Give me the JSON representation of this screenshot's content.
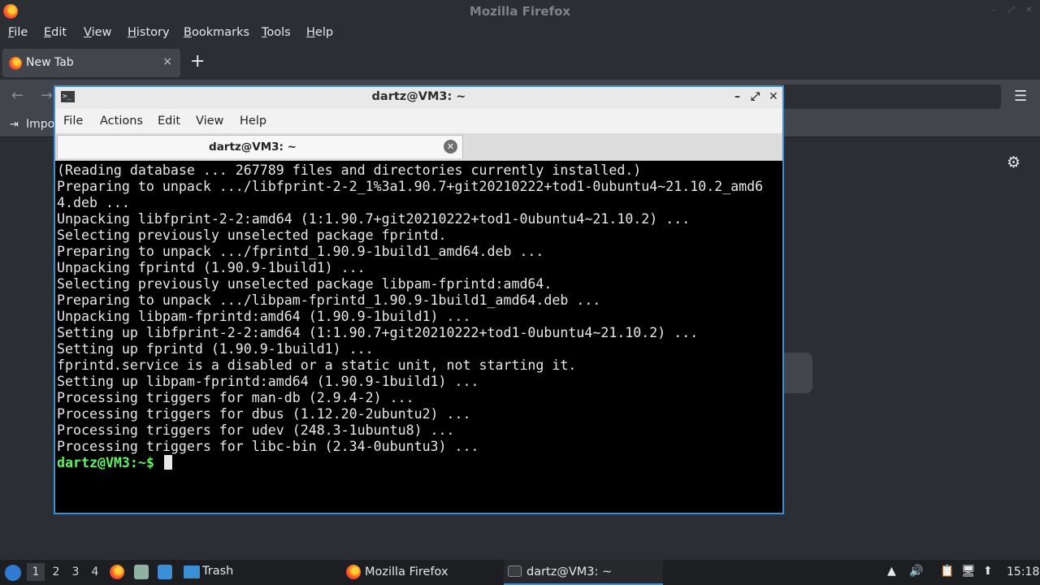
{
  "firefox": {
    "window_title": "Mozilla Firefox",
    "menu": [
      "File",
      "Edit",
      "View",
      "History",
      "Bookmarks",
      "Tools",
      "Help"
    ],
    "tab": {
      "label": "New Tab",
      "close": "×"
    },
    "new_tab_symbol": "+",
    "nav": {
      "back": "←",
      "forward": "→",
      "menu": "☰"
    },
    "bookmarks_toolbar": {
      "import_label": "Impo",
      "import_icon": "⇥"
    },
    "settings_icon": "⚙"
  },
  "terminal": {
    "title": "dartz@VM3: ~",
    "controls": {
      "minimize": "–",
      "maximize": "⤢",
      "close": "✕"
    },
    "menu": [
      "File",
      "Actions",
      "Edit",
      "View",
      "Help"
    ],
    "tab": {
      "label": "dartz@VM3: ~",
      "close": "✕"
    },
    "lines": [
      "(Reading database ... 267789 files and directories currently installed.)",
      "Preparing to unpack .../libfprint-2-2_1%3a1.90.7+git20210222+tod1-0ubuntu4~21.10.2_amd6",
      "4.deb ...",
      "Unpacking libfprint-2-2:amd64 (1:1.90.7+git20210222+tod1-0ubuntu4~21.10.2) ...",
      "Selecting previously unselected package fprintd.",
      "Preparing to unpack .../fprintd_1.90.9-1build1_amd64.deb ...",
      "Unpacking fprintd (1.90.9-1build1) ...",
      "Selecting previously unselected package libpam-fprintd:amd64.",
      "Preparing to unpack .../libpam-fprintd_1.90.9-1build1_amd64.deb ...",
      "Unpacking libpam-fprintd:amd64 (1.90.9-1build1) ...",
      "Setting up libfprint-2-2:amd64 (1:1.90.7+git20210222+tod1-0ubuntu4~21.10.2) ...",
      "Setting up fprintd (1.90.9-1build1) ...",
      "fprintd.service is a disabled or a static unit, not starting it.",
      "Setting up libpam-fprintd:amd64 (1.90.9-1build1) ...",
      "Processing triggers for man-db (2.9.4-2) ...",
      "Processing triggers for dbus (1.12.20-2ubuntu2) ...",
      "Processing triggers for udev (248.3-1ubuntu8) ...",
      "Processing triggers for libc-bin (2.34-0ubuntu3) ..."
    ],
    "prompt_user": "dartz@VM3:",
    "prompt_path": "~$"
  },
  "taskbar": {
    "workspaces": [
      "1",
      "2",
      "3",
      "4"
    ],
    "trash_label": "Trash",
    "tasks": [
      "Mozilla Firefox",
      "dartz@VM3: ~"
    ],
    "clock": "15:18"
  }
}
